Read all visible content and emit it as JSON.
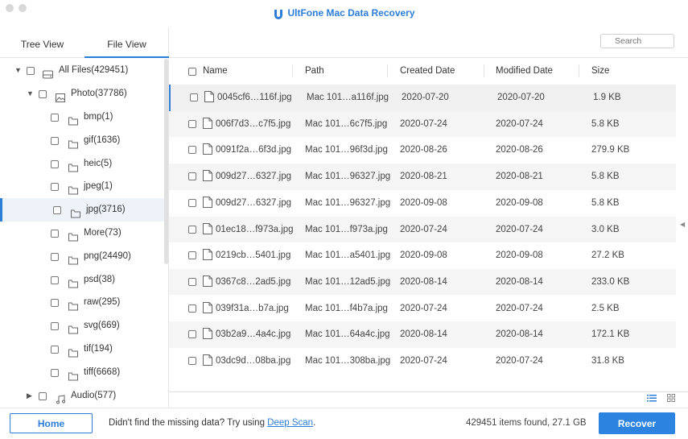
{
  "app": {
    "title": "UltFone Mac Data Recovery"
  },
  "tabs": {
    "tree": "Tree View",
    "file": "File View"
  },
  "tree": {
    "all_files": "All Files(429451)",
    "photo": "Photo(37786)",
    "folders": [
      "bmp(1)",
      "gif(1636)",
      "heic(5)",
      "jpeg(1)",
      "jpg(3716)",
      "More(73)",
      "png(24490)",
      "psd(38)",
      "raw(295)",
      "svg(669)",
      "tif(194)",
      "tiff(6668)"
    ],
    "audio": "Audio(577)"
  },
  "search": {
    "placeholder": "Search"
  },
  "table": {
    "headers": {
      "name": "Name",
      "path": "Path",
      "created": "Created Date",
      "modified": "Modified Date",
      "size": "Size"
    },
    "rows": [
      {
        "name": "0045cf6…116f.jpg",
        "path": "Mac 101…a116f.jpg",
        "created": "2020-07-20",
        "modified": "2020-07-20",
        "size": "1.9 KB"
      },
      {
        "name": "006f7d3…c7f5.jpg",
        "path": "Mac 101…6c7f5.jpg",
        "created": "2020-07-24",
        "modified": "2020-07-24",
        "size": "5.8 KB"
      },
      {
        "name": "0091f2a…6f3d.jpg",
        "path": "Mac 101…96f3d.jpg",
        "created": "2020-08-26",
        "modified": "2020-08-26",
        "size": "279.9 KB"
      },
      {
        "name": "009d27…6327.jpg",
        "path": "Mac 101…96327.jpg",
        "created": "2020-08-21",
        "modified": "2020-08-21",
        "size": "5.8 KB"
      },
      {
        "name": "009d27…6327.jpg",
        "path": "Mac 101…96327.jpg",
        "created": "2020-09-08",
        "modified": "2020-09-08",
        "size": "5.8 KB"
      },
      {
        "name": "01ec18…f973a.jpg",
        "path": "Mac 101…f973a.jpg",
        "created": "2020-07-24",
        "modified": "2020-07-24",
        "size": "3.0 KB"
      },
      {
        "name": "0219cb…5401.jpg",
        "path": "Mac 101…a5401.jpg",
        "created": "2020-09-08",
        "modified": "2020-09-08",
        "size": "27.2 KB"
      },
      {
        "name": "0367c8…2ad5.jpg",
        "path": "Mac 101…12ad5.jpg",
        "created": "2020-08-14",
        "modified": "2020-08-14",
        "size": "233.0 KB"
      },
      {
        "name": "039f31a…b7a.jpg",
        "path": "Mac 101…f4b7a.jpg",
        "created": "2020-07-24",
        "modified": "2020-07-24",
        "size": "2.5 KB"
      },
      {
        "name": "03b2a9…4a4c.jpg",
        "path": "Mac 101…64a4c.jpg",
        "created": "2020-08-14",
        "modified": "2020-08-14",
        "size": "172.1 KB"
      },
      {
        "name": "03dc9d…08ba.jpg",
        "path": "Mac 101…308ba.jpg",
        "created": "2020-07-24",
        "modified": "2020-07-24",
        "size": "31.8 KB"
      }
    ]
  },
  "bottom": {
    "home": "Home",
    "msg_prefix": "Didn't find the missing data? Try using ",
    "deep_scan": "Deep Scan",
    "msg_suffix": ".",
    "count": "429451 items found, 27.1 GB",
    "recover": "Recover"
  },
  "colors": {
    "accent": "#2c7ed6",
    "recover_bg": "#2d84e0"
  }
}
